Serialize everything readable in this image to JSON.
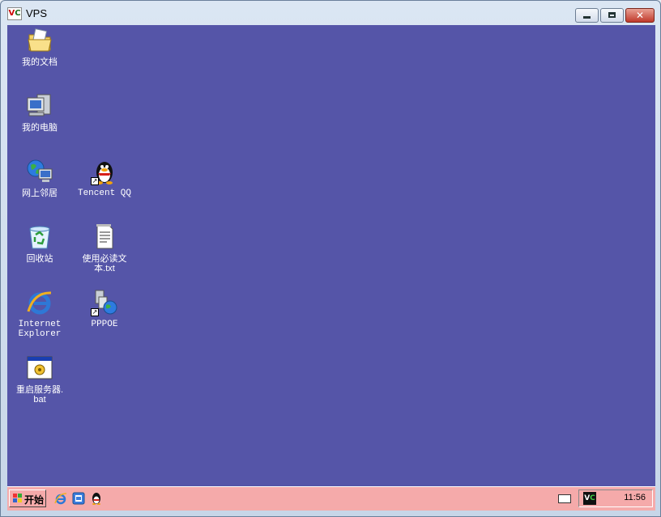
{
  "window": {
    "title": "VPS",
    "app_icon_text": "VC",
    "close_glyph": "✕"
  },
  "desktop": {
    "background": "#5555a8",
    "icons": [
      {
        "label": "我的文档",
        "icon": "my-documents-icon"
      },
      {
        "label": "我的电脑",
        "icon": "my-computer-icon"
      },
      {
        "label": "网上邻居",
        "icon": "network-places-icon"
      },
      {
        "label": "回收站",
        "icon": "recycle-bin-icon"
      },
      {
        "label": "Internet\nExplorer",
        "icon": "internet-explorer-icon"
      },
      {
        "label": "重启服务器.\nbat",
        "icon": "batch-file-icon"
      },
      {
        "label": "Tencent QQ",
        "icon": "qq-penguin-icon"
      },
      {
        "label": "使用必读文\n本.txt",
        "icon": "text-file-icon"
      },
      {
        "label": "PPPOE",
        "icon": "pppoe-connection-icon"
      }
    ]
  },
  "taskbar": {
    "background": "#f5aaaa",
    "start_label": "开始",
    "quick_launch": [
      "internet-explorer-icon",
      "show-desktop-icon",
      "qq-penguin-icon"
    ],
    "tray": {
      "keyboard_icon": "keyboard-icon",
      "vnc_icon_text": "VC",
      "clock": "11:56"
    }
  }
}
